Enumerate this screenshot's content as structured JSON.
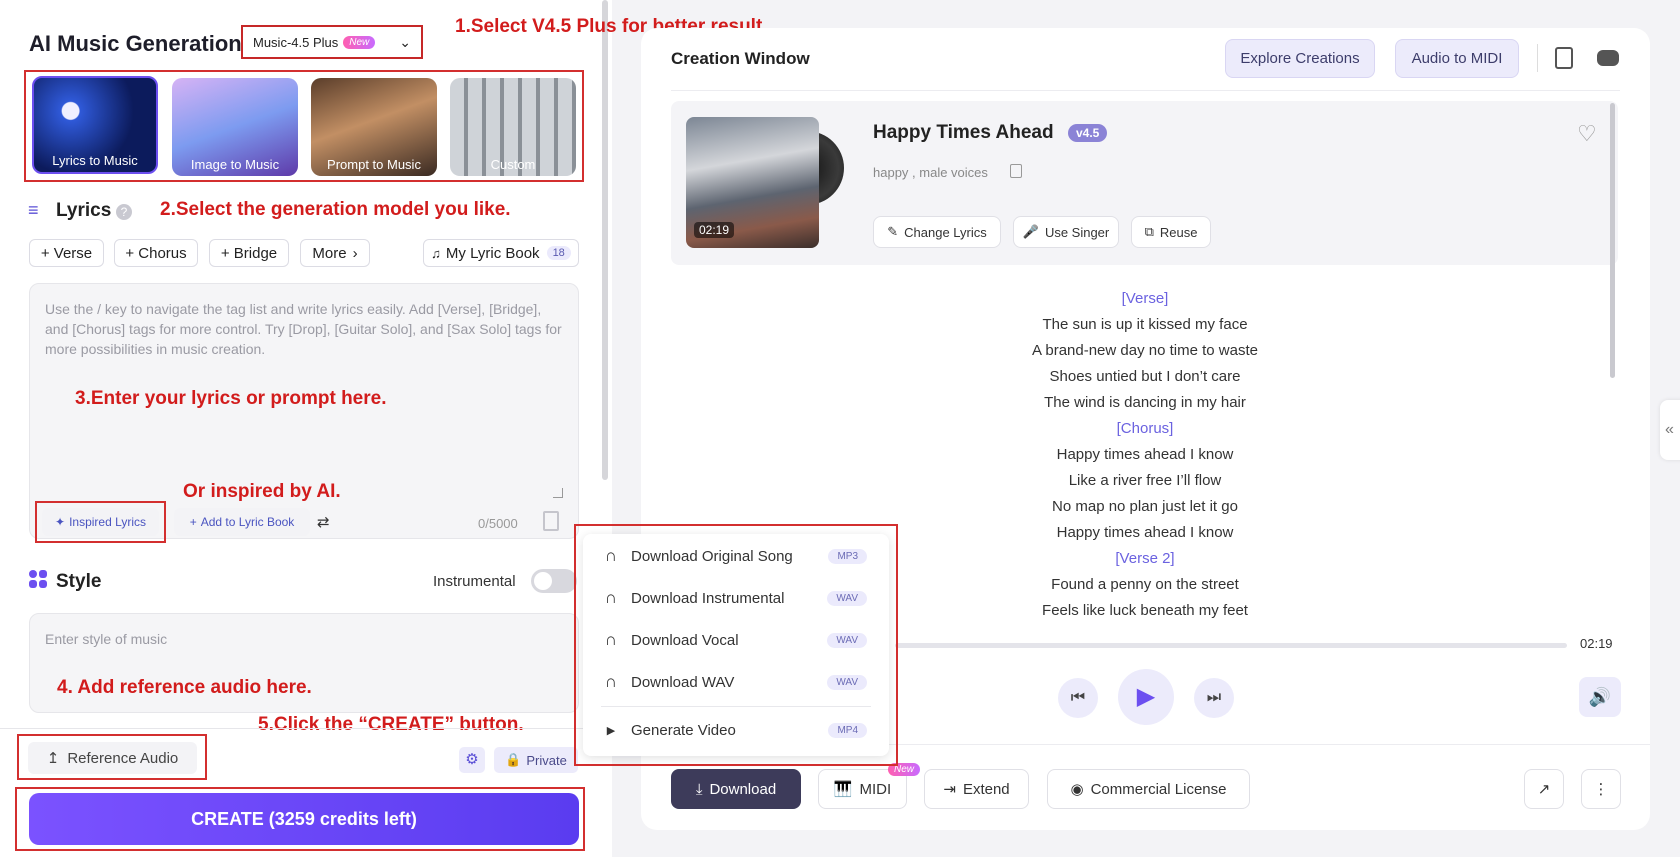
{
  "left": {
    "title": "AI Music Generation",
    "model": {
      "label": "Music-4.5 Plus",
      "badge": "New"
    },
    "cards": [
      "Lyrics to Music",
      "Image to Music",
      "Prompt to Music",
      "Custom"
    ],
    "lyrics": {
      "heading": "Lyrics",
      "chips": [
        "+ Verse",
        "+ Chorus",
        "+ Bridge",
        "More"
      ],
      "lyric_book": "My Lyric Book",
      "lyric_book_count": "18",
      "placeholder": "Use the / key to navigate the tag list and write lyrics easily. Add [Verse], [Bridge], and [Chorus] tags for more control. Try [Drop], [Guitar Solo], and [Sax Solo] tags for more possibilities in music creation.",
      "inspired": "Inspired Lyrics",
      "add_to_book": "Add to Lyric Book",
      "counter": "0/5000"
    },
    "style": {
      "heading": "Style",
      "instrumental": "Instrumental",
      "placeholder": "Enter style of music"
    },
    "reference_audio": "Reference Audio",
    "private": "Private",
    "create": "CREATE (3259 credits left)"
  },
  "annotations": {
    "a1": "1.Select V4.5 Plus for better result.",
    "a2": "2.Select the generation model you like.",
    "a3": "3.Enter your lyrics or prompt here.",
    "a3b": "Or inspired by AI.",
    "a4": "4. Add reference audio here.",
    "a5": "5.Click the “CREATE” button."
  },
  "right": {
    "window_title": "Creation Window",
    "explore": "Explore Creations",
    "audio_midi": "Audio to MIDI",
    "song": {
      "title": "Happy Times Ahead",
      "version": "v4.5",
      "tags": "happy , male voices",
      "duration": "02:19",
      "actions": [
        "Change Lyrics",
        "Use Singer",
        "Reuse"
      ]
    },
    "lyrics": [
      {
        "text": "[Verse]",
        "tag": true
      },
      {
        "text": "The sun is up it kissed my face",
        "tag": false
      },
      {
        "text": "A brand-new day no time to waste",
        "tag": false
      },
      {
        "text": "Shoes untied but I don’t care",
        "tag": false
      },
      {
        "text": "The wind is dancing in my hair",
        "tag": false
      },
      {
        "text": "[Chorus]",
        "tag": true
      },
      {
        "text": "Happy times ahead I know",
        "tag": false
      },
      {
        "text": "Like a river free I’ll flow",
        "tag": false
      },
      {
        "text": "No map no plan just let it go",
        "tag": false
      },
      {
        "text": "Happy times ahead I know",
        "tag": false
      },
      {
        "text": "[Verse 2]",
        "tag": true
      },
      {
        "text": "Found a penny on the street",
        "tag": false
      },
      {
        "text": "Feels like luck beneath my feet",
        "tag": false
      }
    ],
    "player": {
      "total": "02:19"
    },
    "bottom": {
      "download": "Download",
      "midi": "MIDI",
      "midi_badge": "New",
      "extend": "Extend",
      "license": "Commercial License"
    },
    "download_menu": [
      {
        "label": "Download Original Song",
        "fmt": "MP3"
      },
      {
        "label": "Download Instrumental",
        "fmt": "WAV"
      },
      {
        "label": "Download Vocal",
        "fmt": "WAV"
      },
      {
        "label": "Download WAV",
        "fmt": "WAV"
      },
      {
        "label": "Generate Video",
        "fmt": "MP4"
      }
    ]
  },
  "colors": {
    "accent": "#6c4ff0",
    "annotation": "#d21c1c",
    "dark_button": "#3d3b5a"
  }
}
